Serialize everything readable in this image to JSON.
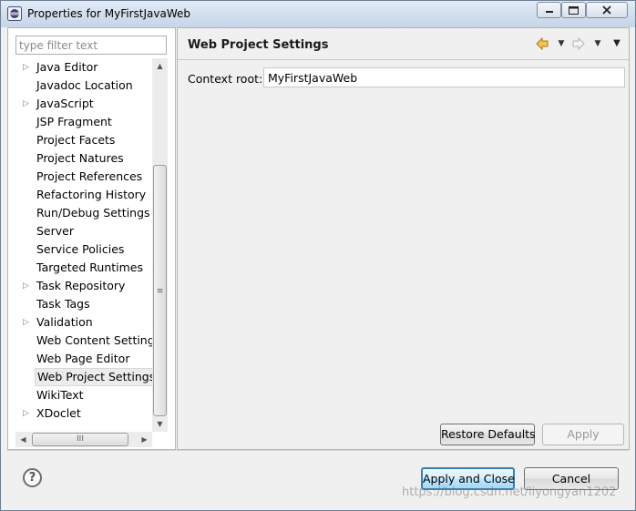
{
  "window": {
    "title": "Properties for MyFirstJavaWeb",
    "controls": {
      "minimize": "minimize",
      "maximize": "maximize",
      "close": "close"
    }
  },
  "sidebar": {
    "filter_placeholder": "type filter text",
    "items": [
      {
        "label": "Java Editor",
        "expandable": true
      },
      {
        "label": "Javadoc Location",
        "expandable": false
      },
      {
        "label": "JavaScript",
        "expandable": true
      },
      {
        "label": "JSP Fragment",
        "expandable": false
      },
      {
        "label": "Project Facets",
        "expandable": false
      },
      {
        "label": "Project Natures",
        "expandable": false
      },
      {
        "label": "Project References",
        "expandable": false
      },
      {
        "label": "Refactoring History",
        "expandable": false
      },
      {
        "label": "Run/Debug Settings",
        "expandable": false
      },
      {
        "label": "Server",
        "expandable": false
      },
      {
        "label": "Service Policies",
        "expandable": false
      },
      {
        "label": "Targeted Runtimes",
        "expandable": false
      },
      {
        "label": "Task Repository",
        "expandable": true
      },
      {
        "label": "Task Tags",
        "expandable": false
      },
      {
        "label": "Validation",
        "expandable": true
      },
      {
        "label": "Web Content Settings",
        "expandable": false
      },
      {
        "label": "Web Page Editor",
        "expandable": false
      },
      {
        "label": "Web Project Settings",
        "expandable": false,
        "selected": true
      },
      {
        "label": "WikiText",
        "expandable": false
      },
      {
        "label": "XDoclet",
        "expandable": true
      }
    ]
  },
  "page": {
    "title": "Web Project Settings",
    "context_root_label": "Context root:",
    "context_root_value": "MyFirstJavaWeb",
    "restore_defaults_label": "Restore Defaults",
    "apply_label": "Apply"
  },
  "footer": {
    "help_symbol": "?",
    "apply_close_label": "Apply and Close",
    "cancel_label": "Cancel"
  },
  "watermark": "https://blog.csdn.net/liyongyan1202",
  "icons": {
    "app": "eclipse-icon",
    "back": "back-arrow-icon",
    "forward": "forward-arrow-icon",
    "view_menu": "view-menu-icon",
    "help": "help-icon"
  },
  "colors": {
    "window_bg": "#f0f0f0",
    "default_button_border": "#3c7fb1",
    "back_arrow": "#d9a020"
  }
}
